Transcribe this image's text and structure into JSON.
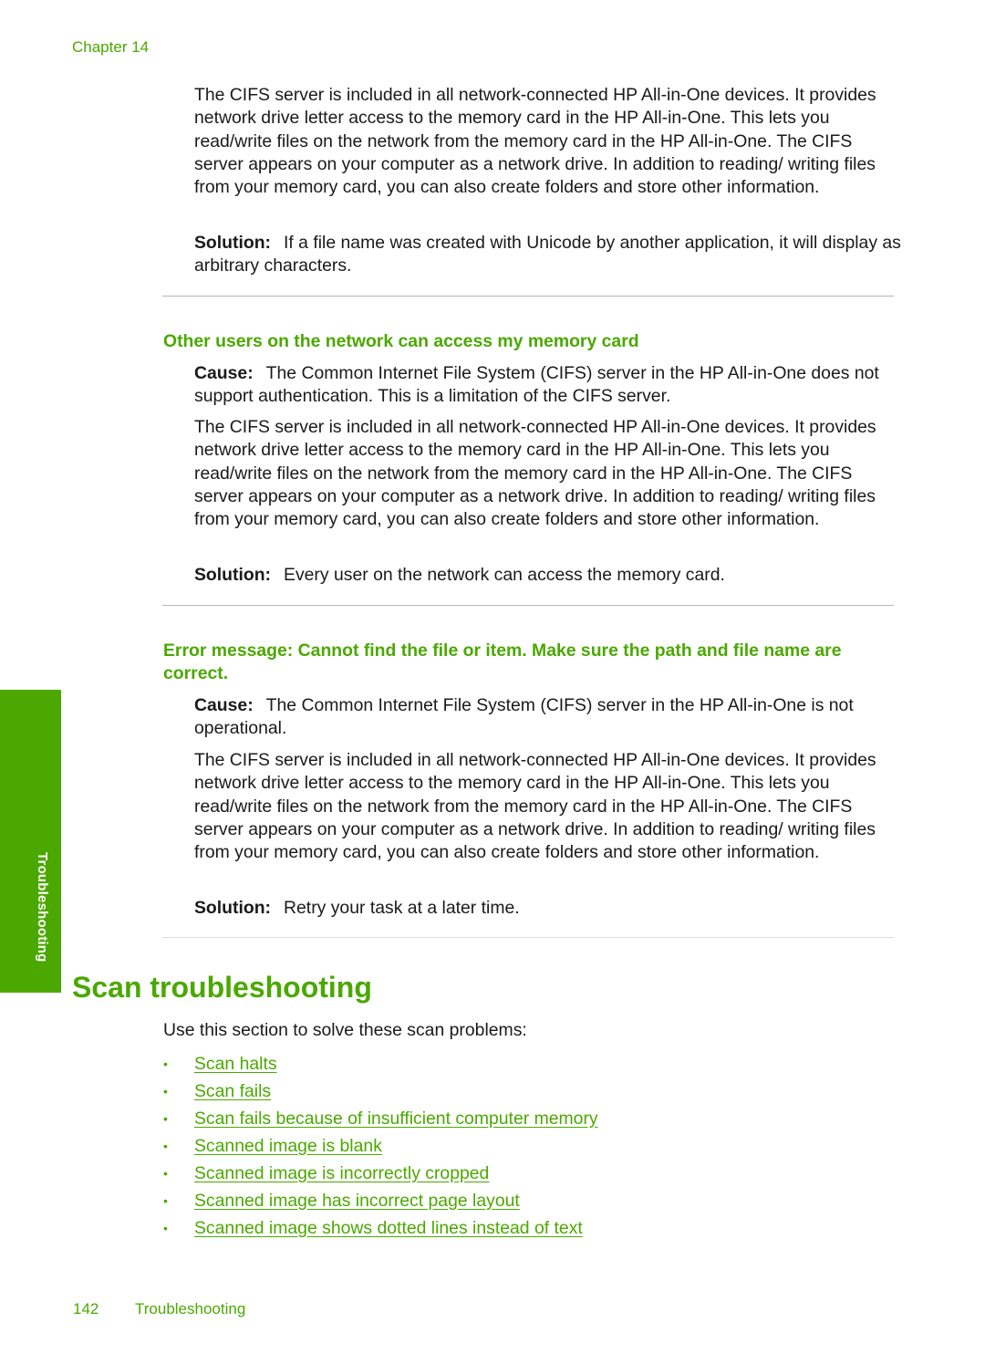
{
  "header": {
    "chapter": "Chapter 14"
  },
  "side_tab": {
    "label": "Troubleshooting"
  },
  "block1": {
    "paragraph": "The CIFS server is included in all network-connected HP All-in-One devices. It provides network drive letter access to the memory card in the HP All-in-One. This lets you read/write files on the network from the memory card in the HP All-in-One. The CIFS server appears on your computer as a network drive. In addition to reading/ writing files from your memory card, you can also create folders and store other information.",
    "solution_label": "Solution:",
    "solution_text": "If a file name was created with Unicode by another application, it will display as arbitrary characters."
  },
  "block2": {
    "heading": "Other users on the network can access my memory card",
    "cause_label": "Cause:",
    "cause_text": "The Common Internet File System (CIFS) server in the HP All-in-One does not support authentication. This is a limitation of the CIFS server.",
    "paragraph": "The CIFS server is included in all network-connected HP All-in-One devices. It provides network drive letter access to the memory card in the HP All-in-One. This lets you read/write files on the network from the memory card in the HP All-in-One. The CIFS server appears on your computer as a network drive. In addition to reading/ writing files from your memory card, you can also create folders and store other information.",
    "solution_label": "Solution:",
    "solution_text": "Every user on the network can access the memory card."
  },
  "block3": {
    "heading": "Error message: Cannot find the file or item. Make sure the path and file name are correct.",
    "cause_label": "Cause:",
    "cause_text": "The Common Internet File System (CIFS) server in the HP All-in-One is not operational.",
    "paragraph": "The CIFS server is included in all network-connected HP All-in-One devices. It provides network drive letter access to the memory card in the HP All-in-One. This lets you read/write files on the network from the memory card in the HP All-in-One. The CIFS server appears on your computer as a network drive. In addition to reading/ writing files from your memory card, you can also create folders and store other information.",
    "solution_label": "Solution:",
    "solution_text": "Retry your task at a later time."
  },
  "scan_section": {
    "title": "Scan troubleshooting",
    "intro": "Use this section to solve these scan problems:",
    "bullet": "•",
    "links": [
      "Scan halts",
      "Scan fails",
      "Scan fails because of insufficient computer memory",
      "Scanned image is blank",
      "Scanned image is incorrectly cropped",
      "Scanned image has incorrect page layout",
      "Scanned image shows dotted lines instead of text"
    ]
  },
  "footer": {
    "page_number": "142",
    "section": "Troubleshooting"
  },
  "colors": {
    "accent": "#4ba800",
    "text": "#1a1a1a",
    "rule": "#b5b5b5"
  }
}
